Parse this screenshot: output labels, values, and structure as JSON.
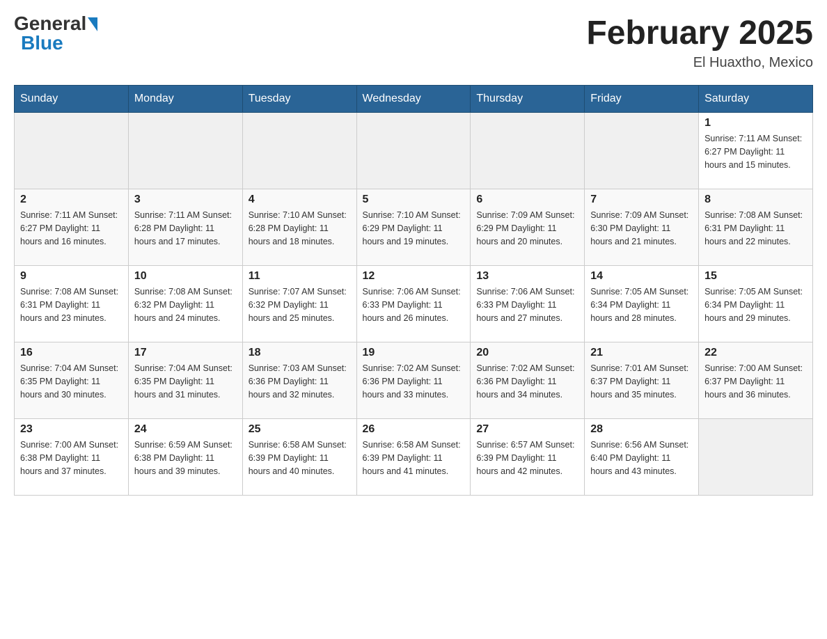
{
  "header": {
    "logo_general": "General",
    "logo_blue": "Blue",
    "title": "February 2025",
    "subtitle": "El Huaxtho, Mexico"
  },
  "days_of_week": [
    "Sunday",
    "Monday",
    "Tuesday",
    "Wednesday",
    "Thursday",
    "Friday",
    "Saturday"
  ],
  "weeks": [
    [
      {
        "day": "",
        "info": ""
      },
      {
        "day": "",
        "info": ""
      },
      {
        "day": "",
        "info": ""
      },
      {
        "day": "",
        "info": ""
      },
      {
        "day": "",
        "info": ""
      },
      {
        "day": "",
        "info": ""
      },
      {
        "day": "1",
        "info": "Sunrise: 7:11 AM\nSunset: 6:27 PM\nDaylight: 11 hours and 15 minutes."
      }
    ],
    [
      {
        "day": "2",
        "info": "Sunrise: 7:11 AM\nSunset: 6:27 PM\nDaylight: 11 hours and 16 minutes."
      },
      {
        "day": "3",
        "info": "Sunrise: 7:11 AM\nSunset: 6:28 PM\nDaylight: 11 hours and 17 minutes."
      },
      {
        "day": "4",
        "info": "Sunrise: 7:10 AM\nSunset: 6:28 PM\nDaylight: 11 hours and 18 minutes."
      },
      {
        "day": "5",
        "info": "Sunrise: 7:10 AM\nSunset: 6:29 PM\nDaylight: 11 hours and 19 minutes."
      },
      {
        "day": "6",
        "info": "Sunrise: 7:09 AM\nSunset: 6:29 PM\nDaylight: 11 hours and 20 minutes."
      },
      {
        "day": "7",
        "info": "Sunrise: 7:09 AM\nSunset: 6:30 PM\nDaylight: 11 hours and 21 minutes."
      },
      {
        "day": "8",
        "info": "Sunrise: 7:08 AM\nSunset: 6:31 PM\nDaylight: 11 hours and 22 minutes."
      }
    ],
    [
      {
        "day": "9",
        "info": "Sunrise: 7:08 AM\nSunset: 6:31 PM\nDaylight: 11 hours and 23 minutes."
      },
      {
        "day": "10",
        "info": "Sunrise: 7:08 AM\nSunset: 6:32 PM\nDaylight: 11 hours and 24 minutes."
      },
      {
        "day": "11",
        "info": "Sunrise: 7:07 AM\nSunset: 6:32 PM\nDaylight: 11 hours and 25 minutes."
      },
      {
        "day": "12",
        "info": "Sunrise: 7:06 AM\nSunset: 6:33 PM\nDaylight: 11 hours and 26 minutes."
      },
      {
        "day": "13",
        "info": "Sunrise: 7:06 AM\nSunset: 6:33 PM\nDaylight: 11 hours and 27 minutes."
      },
      {
        "day": "14",
        "info": "Sunrise: 7:05 AM\nSunset: 6:34 PM\nDaylight: 11 hours and 28 minutes."
      },
      {
        "day": "15",
        "info": "Sunrise: 7:05 AM\nSunset: 6:34 PM\nDaylight: 11 hours and 29 minutes."
      }
    ],
    [
      {
        "day": "16",
        "info": "Sunrise: 7:04 AM\nSunset: 6:35 PM\nDaylight: 11 hours and 30 minutes."
      },
      {
        "day": "17",
        "info": "Sunrise: 7:04 AM\nSunset: 6:35 PM\nDaylight: 11 hours and 31 minutes."
      },
      {
        "day": "18",
        "info": "Sunrise: 7:03 AM\nSunset: 6:36 PM\nDaylight: 11 hours and 32 minutes."
      },
      {
        "day": "19",
        "info": "Sunrise: 7:02 AM\nSunset: 6:36 PM\nDaylight: 11 hours and 33 minutes."
      },
      {
        "day": "20",
        "info": "Sunrise: 7:02 AM\nSunset: 6:36 PM\nDaylight: 11 hours and 34 minutes."
      },
      {
        "day": "21",
        "info": "Sunrise: 7:01 AM\nSunset: 6:37 PM\nDaylight: 11 hours and 35 minutes."
      },
      {
        "day": "22",
        "info": "Sunrise: 7:00 AM\nSunset: 6:37 PM\nDaylight: 11 hours and 36 minutes."
      }
    ],
    [
      {
        "day": "23",
        "info": "Sunrise: 7:00 AM\nSunset: 6:38 PM\nDaylight: 11 hours and 37 minutes."
      },
      {
        "day": "24",
        "info": "Sunrise: 6:59 AM\nSunset: 6:38 PM\nDaylight: 11 hours and 39 minutes."
      },
      {
        "day": "25",
        "info": "Sunrise: 6:58 AM\nSunset: 6:39 PM\nDaylight: 11 hours and 40 minutes."
      },
      {
        "day": "26",
        "info": "Sunrise: 6:58 AM\nSunset: 6:39 PM\nDaylight: 11 hours and 41 minutes."
      },
      {
        "day": "27",
        "info": "Sunrise: 6:57 AM\nSunset: 6:39 PM\nDaylight: 11 hours and 42 minutes."
      },
      {
        "day": "28",
        "info": "Sunrise: 6:56 AM\nSunset: 6:40 PM\nDaylight: 11 hours and 43 minutes."
      },
      {
        "day": "",
        "info": ""
      }
    ]
  ]
}
